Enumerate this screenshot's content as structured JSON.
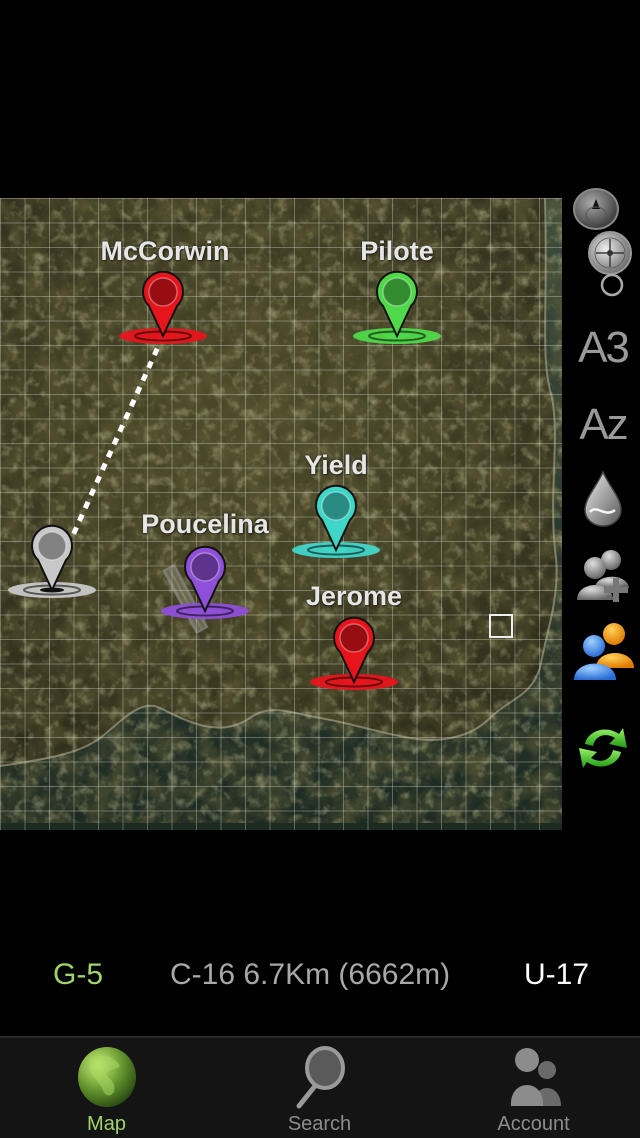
{
  "colors": {
    "background": "#000000",
    "accent_green": "#9ed36a",
    "status_gray": "#a8a8a8",
    "tabbar_bg": "#141414"
  },
  "map": {
    "grid": "on",
    "markers": [
      {
        "name": "McCorwin",
        "color": "#e8141c",
        "icon": "map-pin"
      },
      {
        "name": "Pilote",
        "color": "#4fd94a",
        "icon": "map-pin"
      },
      {
        "name": "Yield",
        "color": "#3fd6c8",
        "icon": "map-pin"
      },
      {
        "name": "Poucelina",
        "color": "#8f4fd9",
        "icon": "map-pin"
      },
      {
        "name": "Jerome",
        "color": "#e8141c",
        "icon": "map-pin"
      },
      {
        "name": "",
        "color": "#c8c8c8",
        "icon": "map-pin-self"
      }
    ],
    "route": {
      "from": "self",
      "to": "McCorwin",
      "style": "dotted-white"
    },
    "selection": {
      "icon": "selected-cell-square"
    }
  },
  "toolbar": {
    "items": [
      {
        "id": "compass",
        "icon": "compass-icon"
      },
      {
        "id": "grid-labels",
        "label": "A3",
        "icon": "grid-coordinate-icon"
      },
      {
        "id": "name-labels",
        "label": "Az",
        "icon": "text-label-icon"
      },
      {
        "id": "drop",
        "icon": "water-drop-icon"
      },
      {
        "id": "add-user",
        "icon": "add-user-icon"
      },
      {
        "id": "users",
        "icon": "users-icon"
      },
      {
        "id": "refresh",
        "icon": "refresh-icon"
      }
    ]
  },
  "status": {
    "current_cell": "G-5",
    "distance": "C-16 6.7Km (6662m)",
    "target_cell": "U-17"
  },
  "tabs": [
    {
      "label": "Map",
      "icon": "globe-icon",
      "active": true
    },
    {
      "label": "Search",
      "icon": "magnifier-icon",
      "active": false
    },
    {
      "label": "Account",
      "icon": "account-icon",
      "active": false
    }
  ]
}
